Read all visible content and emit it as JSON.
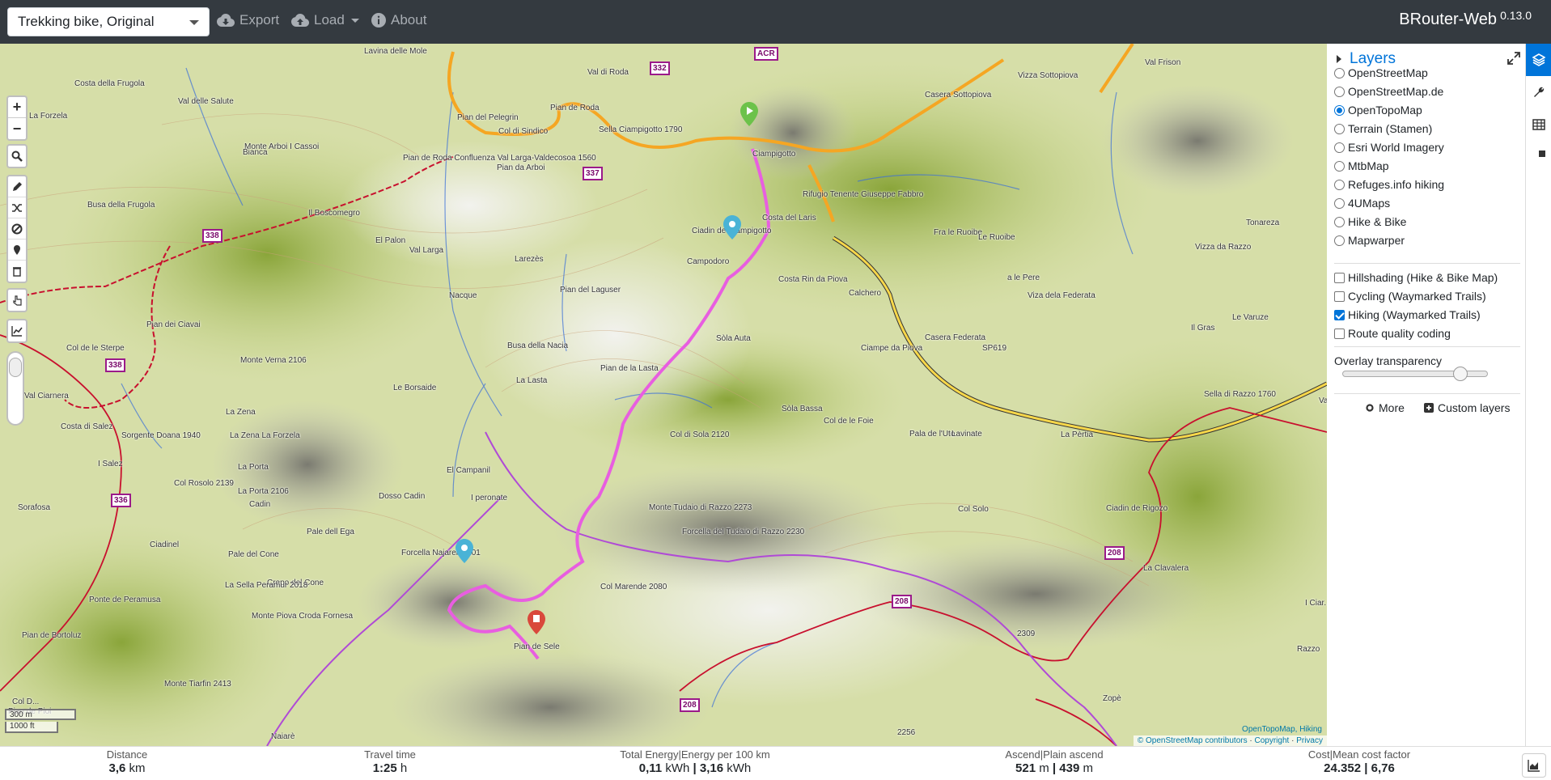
{
  "navbar": {
    "profile": "Trekking bike, Original",
    "export": "Export",
    "load": "Load",
    "about": "About",
    "brand": "BRouter-Web",
    "version": "0.13.0"
  },
  "map": {
    "labels": [
      {
        "text": "Costa della Frugola"
      },
      {
        "text": "Val delle Salute"
      },
      {
        "text": "Lavina delle Mole"
      },
      {
        "text": "Val di Roda"
      },
      {
        "text": "Pian del Pelegrin"
      },
      {
        "text": "Col di Sindico"
      },
      {
        "text": "Pian de Roda"
      },
      {
        "text": "Pian de Roda Confluenza Val Larga-Valdecosoa 1560"
      },
      {
        "text": "Sella Ciampigotto 1790"
      },
      {
        "text": "Ciampigotto"
      },
      {
        "text": "Rifugio Tenente Giuseppe Fabbro"
      },
      {
        "text": "Casera Sottopiova"
      },
      {
        "text": "Vizza Sottopiova"
      },
      {
        "text": "Val Frison"
      },
      {
        "text": "Busa della Frugola"
      },
      {
        "text": "Il Boscomegro"
      },
      {
        "text": "El Palon"
      },
      {
        "text": "Val Larga"
      },
      {
        "text": "Larezès"
      },
      {
        "text": "Ciadin de Ciampigotto"
      },
      {
        "text": "Campodoro"
      },
      {
        "text": "Costa del Laris"
      },
      {
        "text": "Costa Rin da Piova"
      },
      {
        "text": "Calchero"
      },
      {
        "text": "Fra le Ruoibe"
      },
      {
        "text": "Le Ruoibe"
      },
      {
        "text": "a le Pere"
      },
      {
        "text": "Vizza da Razzo"
      },
      {
        "text": "Tonareza"
      },
      {
        "text": "Viza dela Federata"
      },
      {
        "text": "Le Varuze"
      },
      {
        "text": "Il Gras"
      },
      {
        "text": "Pian del Laguser"
      },
      {
        "text": "Nacque"
      },
      {
        "text": "Pian dei Ciavai"
      },
      {
        "text": "Col de le Sterpe"
      },
      {
        "text": "Busa della Nacia"
      },
      {
        "text": "Sòla Auta"
      },
      {
        "text": "Ciampe da Piova"
      },
      {
        "text": "Casera Federata"
      },
      {
        "text": "SP619"
      },
      {
        "text": "Sella di Razzo 1760"
      },
      {
        "text": "Monte Verna 2106"
      },
      {
        "text": "Pian de la Lasta"
      },
      {
        "text": "La Lasta"
      },
      {
        "text": "Le Borsaide"
      },
      {
        "text": "Val Ciarnera"
      },
      {
        "text": "La Zena"
      },
      {
        "text": "Costa di Salez"
      },
      {
        "text": "Sorgente Doana 1940"
      },
      {
        "text": "La Zena La Forzela"
      },
      {
        "text": "Sòla Bassa"
      },
      {
        "text": "Col de le Foie"
      },
      {
        "text": "Pala de l'Uto"
      },
      {
        "text": "Lavinate"
      },
      {
        "text": "La Pèrtia"
      },
      {
        "text": "Col di Sola 2120"
      },
      {
        "text": "I Salez"
      },
      {
        "text": "La Porta"
      },
      {
        "text": "La Porta 2106"
      },
      {
        "text": "El Campanil"
      },
      {
        "text": "I peronate"
      },
      {
        "text": "Sorafosa"
      },
      {
        "text": "Col Rosolo 2139"
      },
      {
        "text": "Dosso Cadin"
      },
      {
        "text": "Cadin"
      },
      {
        "text": "Monte Tudaio di Razzo 2273"
      },
      {
        "text": "Forcella del Tudaio di Razzo 2230"
      },
      {
        "text": "Col Solo"
      },
      {
        "text": "Ciadin de Rigozo"
      },
      {
        "text": "Ciadinel"
      },
      {
        "text": "Pale dell Ega"
      },
      {
        "text": "Pale del Cone"
      },
      {
        "text": "Crepo del Cone"
      },
      {
        "text": "La Sella Peramur 2018"
      },
      {
        "text": "Forcella Najareit 2101"
      },
      {
        "text": "Col Marende 2080"
      },
      {
        "text": "La Clavalera"
      },
      {
        "text": "Ponte de Peramusa"
      },
      {
        "text": "Monte Piova Croda Fornesa"
      },
      {
        "text": "Pian de Sele"
      },
      {
        "text": "Pian de Bortoluz"
      },
      {
        "text": "Monte Tiarfin 2413"
      },
      {
        "text": "2256"
      },
      {
        "text": "2309"
      },
      {
        "text": "Zopè"
      },
      {
        "text": "Pian de Pioi"
      },
      {
        "text": "Col D..."
      },
      {
        "text": "I Ciar..."
      },
      {
        "text": "Razzo"
      },
      {
        "text": "Val Campilu"
      },
      {
        "text": "Naiarè"
      },
      {
        "text": "Pian da Arboi"
      },
      {
        "text": "Monte Arboi I Cassoi"
      },
      {
        "text": "Bianca"
      },
      {
        "text": "La Forzela"
      }
    ],
    "shields": [
      "332",
      "ACR",
      "337",
      "338",
      "338",
      "338",
      "336",
      "208",
      "208",
      "208"
    ],
    "scale_metric": "300 m",
    "scale_imperial": "1000 ft",
    "attr_top": "OpenTopoMap, Hiking",
    "attr_osm": "© OpenStreetMap contributors",
    "attr_copyright": "Copyright",
    "attr_privacy": "Privacy"
  },
  "layers": {
    "title": "Layers",
    "base": [
      {
        "label": "OpenStreetMap",
        "selected": false
      },
      {
        "label": "OpenStreetMap.de",
        "selected": false
      },
      {
        "label": "OpenTopoMap",
        "selected": true
      },
      {
        "label": "Terrain (Stamen)",
        "selected": false
      },
      {
        "label": "Esri World Imagery",
        "selected": false
      },
      {
        "label": "MtbMap",
        "selected": false
      },
      {
        "label": "Refuges.info hiking",
        "selected": false
      },
      {
        "label": "4UMaps",
        "selected": false
      },
      {
        "label": "Hike & Bike",
        "selected": false
      },
      {
        "label": "Mapwarper",
        "selected": false
      }
    ],
    "overlays": [
      {
        "label": "Hillshading (Hike & Bike Map)",
        "checked": false
      },
      {
        "label": "Cycling (Waymarked Trails)",
        "checked": false
      },
      {
        "label": "Hiking (Waymarked Trails)",
        "checked": true
      },
      {
        "label": "Route quality coding",
        "checked": false
      }
    ],
    "transparency_label": "Overlay transparency",
    "transparency_value": 0.8,
    "more": "More",
    "custom": "Custom layers"
  },
  "stats": [
    {
      "label": "Distance",
      "value": "3,6",
      "unit": "km"
    },
    {
      "label": "Travel time",
      "value": "1:25",
      "unit": "h"
    },
    {
      "label": "Total Energy|Energy per 100 km",
      "value": "0,11",
      "unit": "kWh",
      "value2": "3,16",
      "unit2": "kWh"
    },
    {
      "label": "Ascend|Plain ascend",
      "value": "521",
      "unit": "m",
      "value2": "439",
      "unit2": "m"
    },
    {
      "label": "Cost|Mean cost factor",
      "value": "24.352",
      "unit": "",
      "value2": "6,76",
      "unit2": ""
    }
  ],
  "colors": {
    "navbar": "#343a40",
    "accent": "#0074d9",
    "route": "#e85ee0",
    "hiking_trail": "#c8102e",
    "road": "#f5a623"
  }
}
